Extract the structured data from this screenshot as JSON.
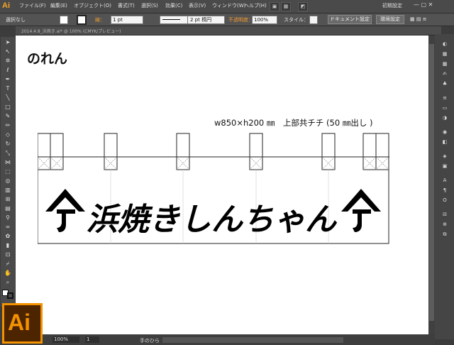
{
  "app": {
    "logo": "Ai",
    "workspace": "初期設定",
    "window_controls": "— ▢ ✕"
  },
  "menu": [
    "ファイル(F)",
    "編集(E)",
    "オブジェクト(O)",
    "書式(T)",
    "選択(S)",
    "効果(C)",
    "表示(V)",
    "ウィンドウ(W)",
    "ヘルプ(H)"
  ],
  "control_bar": {
    "selection": "選択なし",
    "stroke_label": "線：",
    "stroke_value": "1 pt",
    "profile": "均等",
    "brush": "2 pt 楕円",
    "opacity_label": "不透明度：",
    "opacity_value": "100%",
    "style_label": "スタイル：",
    "doc_setup": "ドキュメント設定",
    "preferences": "環境設定"
  },
  "doc_tab": {
    "title": "2014.4.8_浜焼き.ai* @ 100% (CMYK/プレビュー)"
  },
  "status": {
    "zoom": "100%",
    "page": "1",
    "tool": "手のひら"
  },
  "artwork": {
    "title": "のれん",
    "spec": "w850×h200 ㎜　上部共チチ (50 ㎜出し )",
    "banner_text": "浜焼きしんちゃん",
    "ink_color": "#000000"
  },
  "tools": [
    "selection-tool",
    "direct-selection-tool",
    "magic-wand-tool",
    "lasso-tool",
    "pen-tool",
    "type-tool",
    "line-tool",
    "rectangle-tool",
    "paintbrush-tool",
    "pencil-tool",
    "eraser-tool",
    "rotate-tool",
    "scale-tool",
    "width-tool",
    "free-transform-tool",
    "shape-builder-tool",
    "perspective-tool",
    "mesh-tool",
    "gradient-tool",
    "eyedropper-tool",
    "blend-tool",
    "symbol-sprayer-tool",
    "graph-tool",
    "artboard-tool",
    "slice-tool",
    "hand-tool",
    "zoom-tool"
  ],
  "right_panels": [
    "color-panel",
    "color-guide-panel",
    "swatches-panel",
    "brushes-panel",
    "symbols-panel",
    "stroke-panel",
    "gradient-panel",
    "transparency-panel",
    "appearance-panel",
    "graphic-styles-panel",
    "layers-panel",
    "artboards-panel",
    "character-panel",
    "paragraph-panel",
    "opentype-panel",
    "align-panel",
    "transform-panel",
    "pathfinder-panel"
  ]
}
